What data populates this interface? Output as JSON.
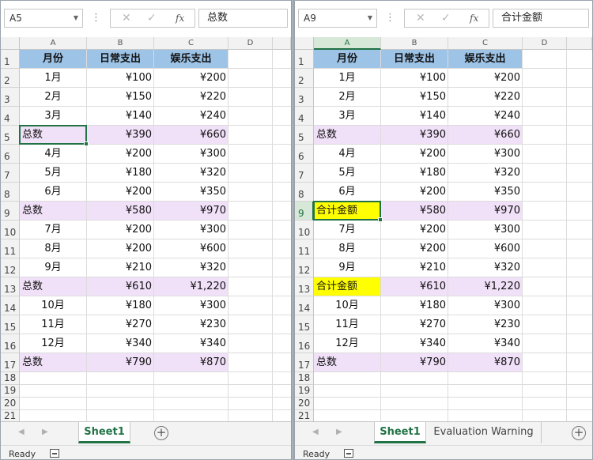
{
  "panes": [
    {
      "id": "left",
      "name_box": "A5",
      "formula_content": "总数",
      "active_cell": {
        "row": 5,
        "col": "A"
      },
      "sheet_tabs": [
        {
          "label": "Sheet1",
          "active": true
        }
      ],
      "status": "Ready"
    },
    {
      "id": "right",
      "name_box": "A9",
      "formula_content": "合计金额",
      "active_cell": {
        "row": 9,
        "col": "A"
      },
      "sheet_tabs": [
        {
          "label": "Sheet1",
          "active": true
        },
        {
          "label": "Evaluation Warning",
          "active": false
        }
      ],
      "status": "Ready"
    }
  ],
  "formula_icons": {
    "cancel": "✕",
    "enter": "✓",
    "fx": "fx"
  },
  "column_letters": [
    "A",
    "B",
    "C",
    "D"
  ],
  "row_numbers": [
    "1",
    "2",
    "3",
    "4",
    "5",
    "6",
    "7",
    "8",
    "9",
    "10",
    "11",
    "12",
    "13",
    "14",
    "15",
    "16",
    "17",
    "18",
    "19",
    "20",
    "21"
  ],
  "left_rows": [
    {
      "a": "月份",
      "b": "日常支出",
      "c": "娱乐支出",
      "kind": "header"
    },
    {
      "a": "1月",
      "b": "¥100",
      "c": "¥200",
      "kind": "month"
    },
    {
      "a": "2月",
      "b": "¥150",
      "c": "¥220",
      "kind": "month"
    },
    {
      "a": "3月",
      "b": "¥140",
      "c": "¥240",
      "kind": "month"
    },
    {
      "a": "总数",
      "b": "¥390",
      "c": "¥660",
      "kind": "total"
    },
    {
      "a": "4月",
      "b": "¥200",
      "c": "¥300",
      "kind": "month"
    },
    {
      "a": "5月",
      "b": "¥180",
      "c": "¥320",
      "kind": "month"
    },
    {
      "a": "6月",
      "b": "¥200",
      "c": "¥350",
      "kind": "month"
    },
    {
      "a": "总数",
      "b": "¥580",
      "c": "¥970",
      "kind": "total"
    },
    {
      "a": "7月",
      "b": "¥200",
      "c": "¥300",
      "kind": "month"
    },
    {
      "a": "8月",
      "b": "¥200",
      "c": "¥600",
      "kind": "month"
    },
    {
      "a": "9月",
      "b": "¥210",
      "c": "¥320",
      "kind": "month"
    },
    {
      "a": "总数",
      "b": "¥610",
      "c": "¥1,220",
      "kind": "total"
    },
    {
      "a": "10月",
      "b": "¥180",
      "c": "¥300",
      "kind": "month"
    },
    {
      "a": "11月",
      "b": "¥270",
      "c": "¥230",
      "kind": "month"
    },
    {
      "a": "12月",
      "b": "¥340",
      "c": "¥340",
      "kind": "month"
    },
    {
      "a": "总数",
      "b": "¥790",
      "c": "¥870",
      "kind": "total"
    }
  ],
  "right_rows": [
    {
      "a": "月份",
      "b": "日常支出",
      "c": "娱乐支出",
      "kind": "header"
    },
    {
      "a": "1月",
      "b": "¥100",
      "c": "¥200",
      "kind": "month"
    },
    {
      "a": "2月",
      "b": "¥150",
      "c": "¥220",
      "kind": "month"
    },
    {
      "a": "3月",
      "b": "¥140",
      "c": "¥240",
      "kind": "month"
    },
    {
      "a": "总数",
      "b": "¥390",
      "c": "¥660",
      "kind": "total"
    },
    {
      "a": "4月",
      "b": "¥200",
      "c": "¥300",
      "kind": "month"
    },
    {
      "a": "5月",
      "b": "¥180",
      "c": "¥320",
      "kind": "month"
    },
    {
      "a": "6月",
      "b": "¥200",
      "c": "¥350",
      "kind": "month"
    },
    {
      "a": "合计金额",
      "b": "¥580",
      "c": "¥970",
      "kind": "total-renamed"
    },
    {
      "a": "7月",
      "b": "¥200",
      "c": "¥300",
      "kind": "month"
    },
    {
      "a": "8月",
      "b": "¥200",
      "c": "¥600",
      "kind": "month"
    },
    {
      "a": "9月",
      "b": "¥210",
      "c": "¥320",
      "kind": "month"
    },
    {
      "a": "合计金额",
      "b": "¥610",
      "c": "¥1,220",
      "kind": "total-renamed"
    },
    {
      "a": "10月",
      "b": "¥180",
      "c": "¥300",
      "kind": "month"
    },
    {
      "a": "11月",
      "b": "¥270",
      "c": "¥230",
      "kind": "month"
    },
    {
      "a": "12月",
      "b": "¥340",
      "c": "¥340",
      "kind": "month"
    },
    {
      "a": "总数",
      "b": "¥790",
      "c": "¥870",
      "kind": "total"
    }
  ],
  "colors": {
    "header_fill": "#9dc3e6",
    "total_fill": "#f0e0f8",
    "highlight_fill": "#ffff00",
    "accent": "#217346"
  },
  "icons": {
    "add_sheet": "plus-circle-icon",
    "macro": "macro-record-icon",
    "nav_prev": "◀",
    "nav_next": "▶"
  }
}
